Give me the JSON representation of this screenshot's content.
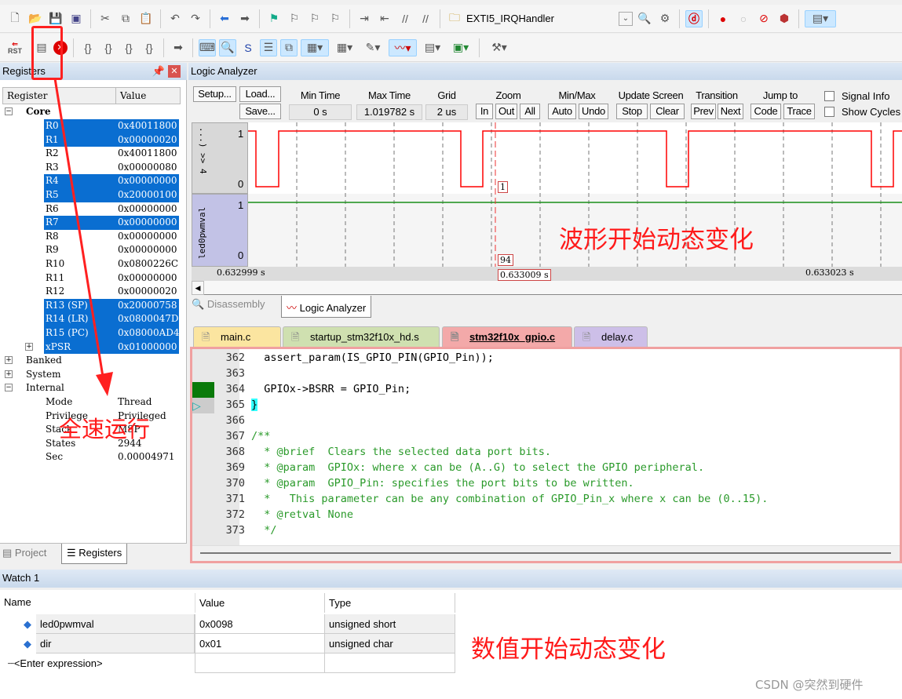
{
  "toolbar": {
    "function_combo": "EXTI5_IRQHandler",
    "rst_label": "RST"
  },
  "registers": {
    "title": "Registers",
    "col_register": "Register",
    "col_value": "Value",
    "groups": {
      "core": "Core",
      "banked": "Banked",
      "system": "System",
      "internal": "Internal"
    },
    "core": [
      {
        "name": "R0",
        "value": "0x40011800",
        "selected": true
      },
      {
        "name": "R1",
        "value": "0x00000020",
        "selected": true
      },
      {
        "name": "R2",
        "value": "0x40011800",
        "selected": false
      },
      {
        "name": "R3",
        "value": "0x00000080",
        "selected": false
      },
      {
        "name": "R4",
        "value": "0x00000000",
        "selected": true
      },
      {
        "name": "R5",
        "value": "0x20000100",
        "selected": true
      },
      {
        "name": "R6",
        "value": "0x00000000",
        "selected": false
      },
      {
        "name": "R7",
        "value": "0x00000000",
        "selected": true
      },
      {
        "name": "R8",
        "value": "0x00000000",
        "selected": false
      },
      {
        "name": "R9",
        "value": "0x00000000",
        "selected": false
      },
      {
        "name": "R10",
        "value": "0x0800226C",
        "selected": false
      },
      {
        "name": "R11",
        "value": "0x00000000",
        "selected": false
      },
      {
        "name": "R12",
        "value": "0x00000020",
        "selected": false
      },
      {
        "name": "R13 (SP)",
        "value": "0x20000758",
        "selected": true
      },
      {
        "name": "R14 (LR)",
        "value": "0x0800047D",
        "selected": true
      },
      {
        "name": "R15 (PC)",
        "value": "0x08000AD4",
        "selected": true
      },
      {
        "name": "xPSR",
        "value": "0x01000000",
        "selected": true
      }
    ],
    "internal": [
      {
        "name": "Mode",
        "value": "Thread"
      },
      {
        "name": "Privilege",
        "value": "Privileged"
      },
      {
        "name": "Stack",
        "value": "MSP"
      },
      {
        "name": "States",
        "value": "2944"
      },
      {
        "name": "Sec",
        "value": "0.00004971"
      }
    ],
    "tabs": [
      "Project",
      "Registers"
    ]
  },
  "logic_analyzer": {
    "title": "Logic Analyzer",
    "buttons": {
      "setup": "Setup...",
      "load": "Load...",
      "save": "Save...",
      "in": "In",
      "out": "Out",
      "all": "All",
      "auto": "Auto",
      "undo": "Undo",
      "stop": "Stop",
      "clear": "Clear",
      "prev": "Prev",
      "next": "Next",
      "code": "Code",
      "trace": "Trace"
    },
    "labels": {
      "min_time": "Min Time",
      "max_time": "Max Time",
      "grid": "Grid",
      "zoom": "Zoom",
      "minmax": "Min/Max",
      "update": "Update Screen",
      "transition": "Transition",
      "jump": "Jump to",
      "signal_info": "Signal Info",
      "show_cycles": "Show Cycles"
    },
    "min_time": "0 s",
    "max_time": "1.019782 s",
    "grid": "2 us",
    "signals": [
      {
        "name": "...) >> 4",
        "max": "1",
        "min": "0",
        "cursor_value": "1",
        "color": "#ff0000"
      },
      {
        "name": "led0pwmval",
        "max": "1",
        "min": "0",
        "cursor_value": "94",
        "color": "#1a8f1a"
      }
    ],
    "time_left": "0.632999 s",
    "time_cursor": "0.633009 s",
    "time_right": "0.633023 s",
    "tabs": [
      "Disassembly",
      "Logic Analyzer"
    ]
  },
  "editor": {
    "tabs": [
      {
        "label": "main.c",
        "color": "#fbe5a0"
      },
      {
        "label": "startup_stm32f10x_hd.s",
        "color": "#cfe0b0"
      },
      {
        "label": "stm32f10x_gpio.c",
        "color": "#f3a9a9"
      },
      {
        "label": "delay.c",
        "color": "#cdbfe8"
      }
    ],
    "lines": [
      {
        "num": "362",
        "text": "  assert_param(IS_GPIO_PIN(GPIO_Pin));",
        "comment": false
      },
      {
        "num": "363",
        "text": "",
        "comment": false
      },
      {
        "num": "364",
        "text": "  GPIOx->BSRR = GPIO_Pin;",
        "comment": false
      },
      {
        "num": "365",
        "text": "}",
        "comment": false
      },
      {
        "num": "366",
        "text": "",
        "comment": false
      },
      {
        "num": "367",
        "text": "/**",
        "comment": true
      },
      {
        "num": "368",
        "text": "  * @brief  Clears the selected data port bits.",
        "comment": true
      },
      {
        "num": "369",
        "text": "  * @param  GPIOx: where x can be (A..G) to select the GPIO peripheral.",
        "comment": true
      },
      {
        "num": "370",
        "text": "  * @param  GPIO_Pin: specifies the port bits to be written.",
        "comment": true
      },
      {
        "num": "371",
        "text": "  *   This parameter can be any combination of GPIO_Pin_x where x can be (0..15).",
        "comment": true
      },
      {
        "num": "372",
        "text": "  * @retval None",
        "comment": true
      },
      {
        "num": "373",
        "text": "  */",
        "comment": true
      }
    ]
  },
  "watch": {
    "title": "Watch 1",
    "col_name": "Name",
    "col_value": "Value",
    "col_type": "Type",
    "rows": [
      {
        "name": "led0pwmval",
        "value": "0x0098",
        "type": "unsigned short"
      },
      {
        "name": "dir",
        "value": "0x01",
        "type": "unsigned char"
      }
    ],
    "enter": "<Enter expression>"
  },
  "annotations": {
    "run": "全速运行",
    "wave": "波形开始动态变化",
    "value": "数值开始动态变化",
    "accent": "#ff1a1a"
  },
  "watermark": "CSDN @突然到硬件"
}
